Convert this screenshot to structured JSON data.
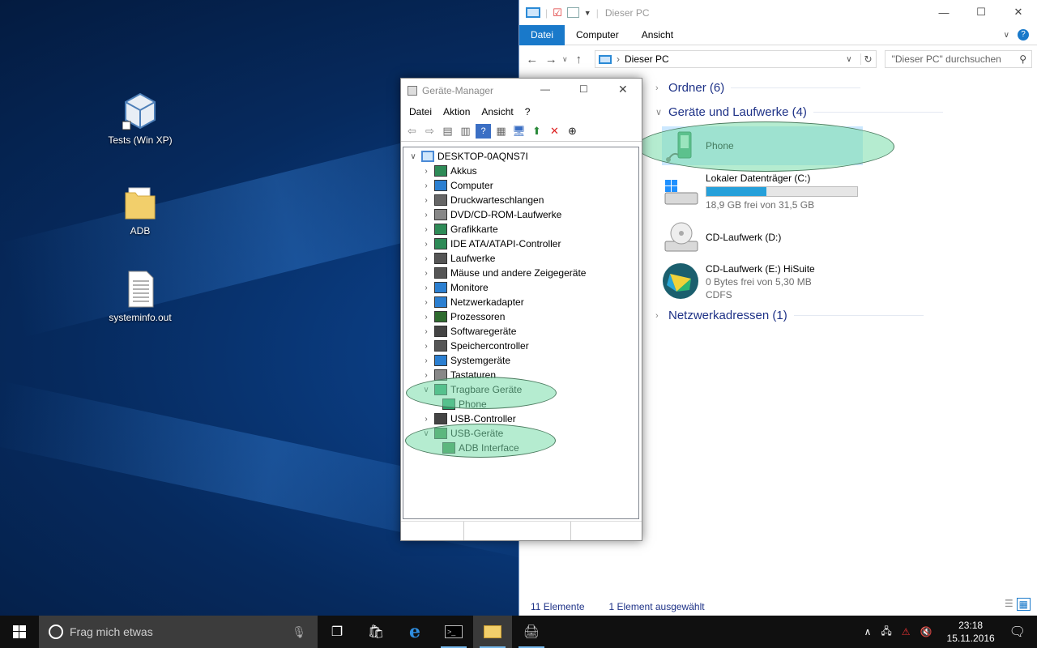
{
  "desktop": {
    "icons": [
      {
        "label": "Tests (Win XP)",
        "icon": "virtualbox-icon"
      },
      {
        "label": "ADB",
        "icon": "folder-icon"
      },
      {
        "label": "systeminfo.out",
        "icon": "document-icon"
      }
    ]
  },
  "explorer": {
    "title": "Dieser PC",
    "window_buttons": {
      "minimize": "—",
      "maximize": "☐",
      "close": "✕"
    },
    "ribbon_tabs": [
      "Datei",
      "Computer",
      "Ansicht"
    ],
    "address": "Dieser PC",
    "search_placeholder": "\"Dieser PC\" durchsuchen",
    "groups": {
      "ordner": "Ordner (6)",
      "geraete": "Geräte und Laufwerke (4)",
      "netzwerk": "Netzwerkadressen (1)"
    },
    "devices": [
      {
        "name": "Phone"
      },
      {
        "name": "Lokaler Datenträger (C:)",
        "detail": "18,9 GB frei von 31,5 GB",
        "used_fraction": 0.4
      },
      {
        "name": "CD-Laufwerk (D:)"
      },
      {
        "name": "CD-Laufwerk (E:) HiSuite",
        "detail": "0 Bytes frei von 5,30 MB",
        "fs": "CDFS"
      }
    ],
    "status": {
      "count": "11 Elemente",
      "selected": "1 Element ausgewählt"
    }
  },
  "device_manager": {
    "title": "Geräte-Manager",
    "menu": [
      "Datei",
      "Aktion",
      "Ansicht",
      "?"
    ],
    "root": "DESKTOP-0AQNS7I",
    "categories": [
      "Akkus",
      "Computer",
      "Druckwarteschlangen",
      "DVD/CD-ROM-Laufwerke",
      "Grafikkarte",
      "IDE ATA/ATAPI-Controller",
      "Laufwerke",
      "Mäuse und andere Zeigegeräte",
      "Monitore",
      "Netzwerkadapter",
      "Prozessoren",
      "Softwaregeräte",
      "Speichercontroller",
      "Systemgeräte",
      "Tastaturen",
      "Tragbare Geräte",
      "Phone",
      "USB-Controller",
      "USB-Geräte",
      "ADB Interface"
    ]
  },
  "taskbar": {
    "search_placeholder": "Frag mich etwas",
    "time": "23:18",
    "date": "15.11.2016"
  }
}
